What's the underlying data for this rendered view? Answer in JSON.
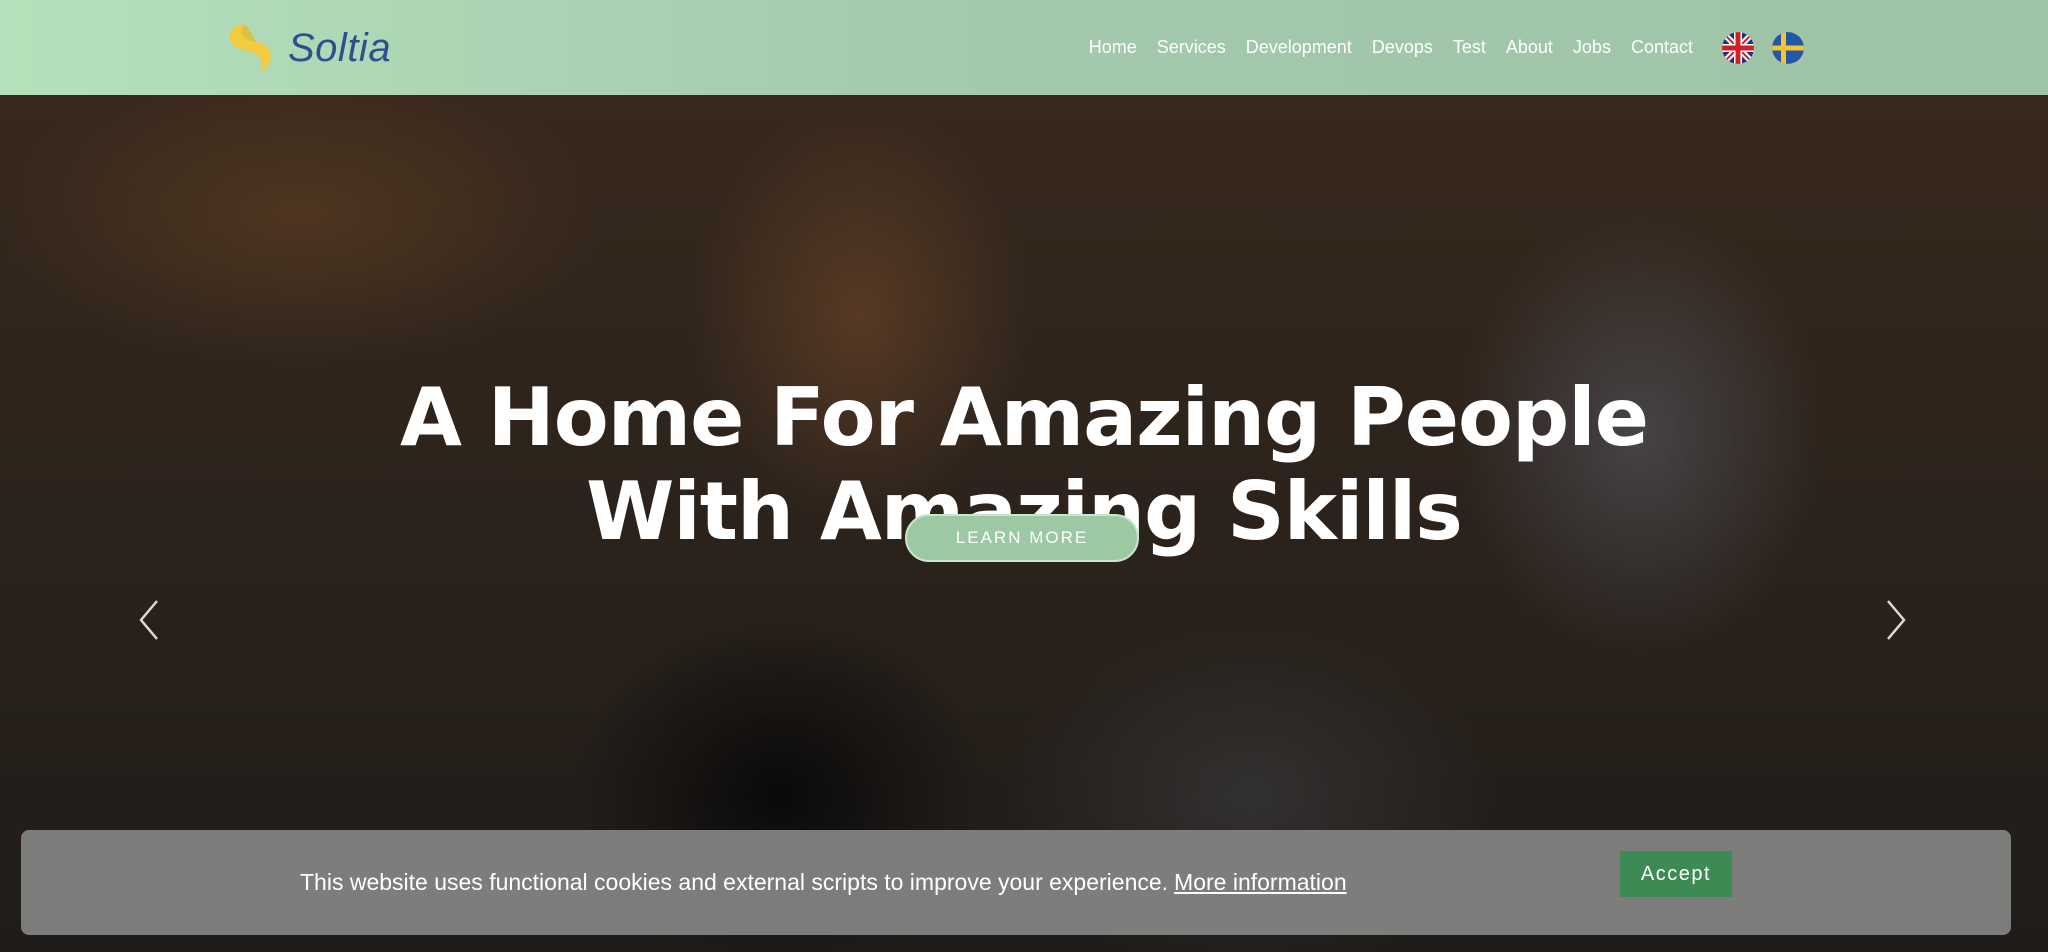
{
  "brand": {
    "name": "Soltia",
    "logo_icon": "soltia-swirl-icon"
  },
  "nav": {
    "items": [
      {
        "label": "Home"
      },
      {
        "label": "Services"
      },
      {
        "label": "Development"
      },
      {
        "label": "Devops"
      },
      {
        "label": "Test"
      },
      {
        "label": "About"
      },
      {
        "label": "Jobs"
      },
      {
        "label": "Contact"
      }
    ],
    "languages": [
      {
        "icon": "uk-flag-icon"
      },
      {
        "icon": "sweden-flag-icon"
      }
    ]
  },
  "hero": {
    "title_line1": "A Home For Amazing People",
    "title_line2": "With Amazing Skills",
    "cta_label": "LEARN MORE",
    "prev_icon": "chevron-left-icon",
    "next_icon": "chevron-right-icon"
  },
  "cookie": {
    "text": "This website uses functional cookies and external scripts to improve your experience.",
    "link_label": "More information",
    "accept_label": "Accept"
  },
  "colors": {
    "header_start": "#b4e1bb",
    "header_end": "#9ec3a6",
    "logo_yellow": "#f2cc3c",
    "logo_text": "#2f4f8f",
    "cta_fill": "#9cc9a4",
    "accept_green": "#3d8a55",
    "cookie_bg": "#808080"
  }
}
